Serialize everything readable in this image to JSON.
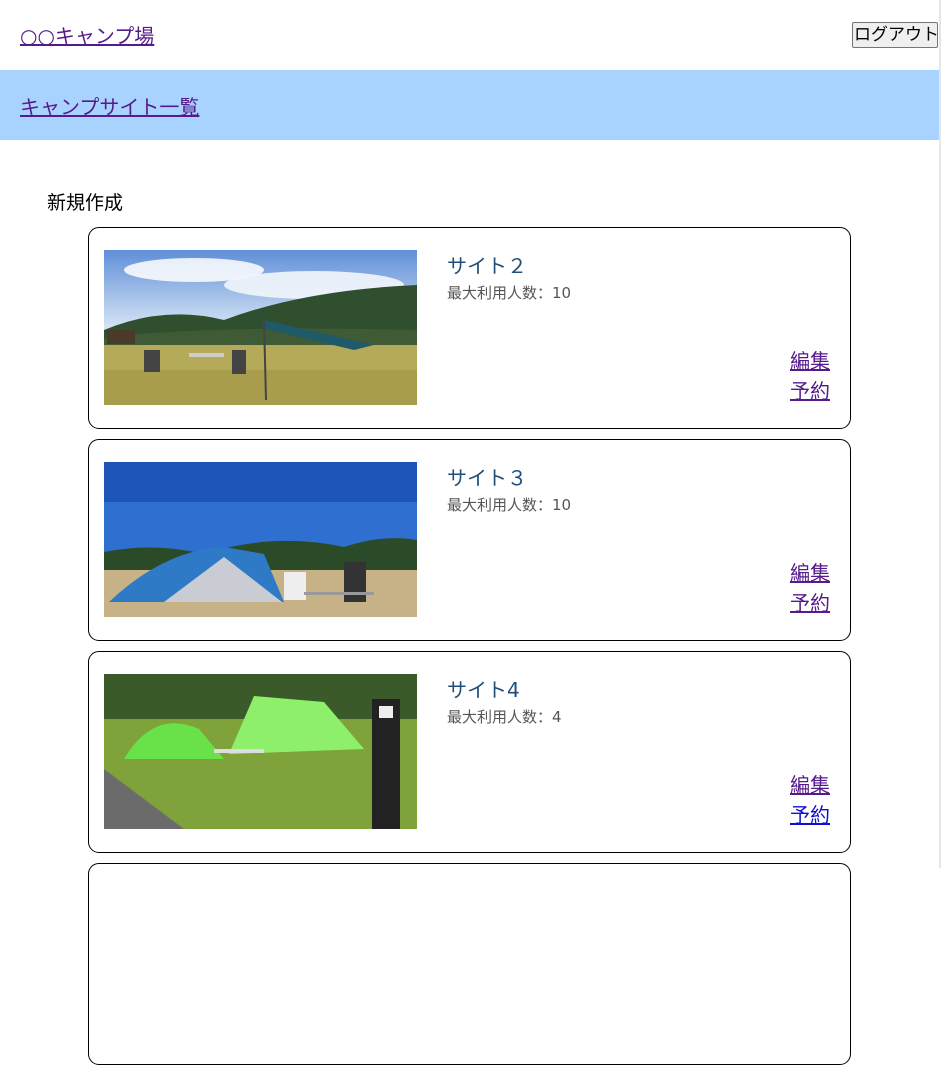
{
  "header": {
    "brand": "○○キャンプ場",
    "logout_label": "ログアウト"
  },
  "subnav": {
    "site_list_label": "キャンプサイト一覧"
  },
  "main": {
    "new_label": "新規作成",
    "sites": [
      {
        "name": "サイト２",
        "capacity_text": "最大利用人数：10",
        "edit_label": "編集",
        "reserve_label": "予約"
      },
      {
        "name": "サイト３",
        "capacity_text": "最大利用人数：10",
        "edit_label": "編集",
        "reserve_label": "予約"
      },
      {
        "name": "サイト4",
        "capacity_text": "最大利用人数：4",
        "edit_label": "編集",
        "reserve_label": "予約"
      }
    ]
  },
  "colors": {
    "subnav_bg": "#a9d3ff",
    "link_visited": "#551a8b",
    "title_text": "#1f4e79"
  }
}
